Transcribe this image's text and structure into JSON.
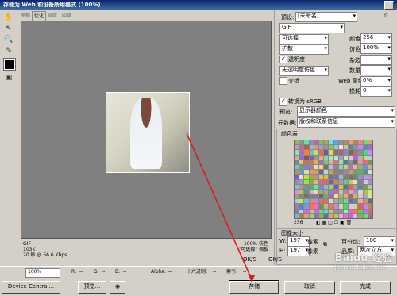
{
  "window": {
    "title": "存储为 Web 和设备所用格式 (100%)"
  },
  "tabs": [
    {
      "label": "原稿",
      "active": false
    },
    {
      "label": "优化",
      "active": true
    },
    {
      "label": "双联",
      "active": false
    },
    {
      "label": "四联",
      "active": false
    }
  ],
  "image_info": {
    "format": "GIF",
    "size": "103K",
    "time": "20 秒 @ 56.6 Kbps",
    "zoom_pct": "100% 仿色",
    "palette_note": "\"可选择\" 调板"
  },
  "status": {
    "zoom": "100%",
    "r_label": "R:",
    "g_label": "G:",
    "b_label": "B:",
    "alpha_label": "Alpha:",
    "hex_label": "十六进制:",
    "index_label": "索引:",
    "r_value": "--",
    "g_value": "--",
    "b_value": "--",
    "alpha_value": "--",
    "hex_value": "--",
    "index_value": "--"
  },
  "buttons": {
    "device_central": "Device Central...",
    "preview": "预览...",
    "save": "存储",
    "cancel": "取消",
    "done": "完成"
  },
  "panel": {
    "preset_label": "预设:",
    "preset_value": "[未命名]",
    "format_value": "GIF",
    "reduction_value": "可选择",
    "colors_label": "颜色:",
    "colors_value": "256",
    "dither_algo": "扩散",
    "dither_label": "仿色:",
    "dither_value": "100%",
    "transparency_label": "透明度",
    "matte_label": "杂边:",
    "transparency_dither": "无透明度仿色",
    "amount_label": "数量:",
    "interlaced_label": "交错",
    "web_snap_label": "Web 靠色:",
    "web_snap_value": "0%",
    "lossy_label": "损耗:",
    "lossy_value": "0",
    "convert_srgb_label": "转换为 sRGB",
    "preview_label": "预览:",
    "preview_value": "显示器颜色",
    "metadata_label": "元数据:",
    "metadata_value": "版权和联系信息",
    "color_table_title": "颜色表",
    "color_count": "256",
    "image_size_title": "图像大小",
    "w_label": "W:",
    "w_value": "197",
    "h_label": "H:",
    "h_value": "197",
    "px_unit": "像素",
    "percent_label": "百分比:",
    "percent_value": "100",
    "quality_label": "品质:",
    "quality_value": "两次立方",
    "anim_ok1": "OK/S",
    "anim_ok2": "OK/S"
  },
  "watermark": {
    "brand": "Baidu 经验",
    "url": "jingyan.baidu.com"
  },
  "colors": {
    "arrow": "#d62020",
    "canvas": "#808080",
    "title": "#0a246a"
  }
}
